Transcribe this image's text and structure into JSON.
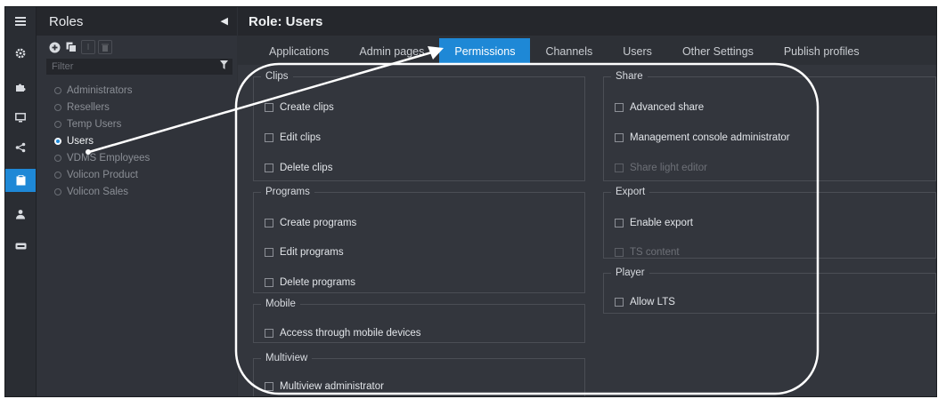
{
  "rail": {
    "items": [
      {
        "icon": "menu-icon"
      },
      {
        "icon": "gear-icon"
      },
      {
        "icon": "puzzle-icon"
      },
      {
        "icon": "monitor-icon"
      },
      {
        "icon": "share-icon"
      },
      {
        "icon": "clipboard-icon"
      },
      {
        "icon": "user-icon"
      },
      {
        "icon": "device-icon"
      }
    ]
  },
  "sidebar": {
    "title": "Roles",
    "filter_placeholder": "Filter",
    "roles": [
      "Administrators",
      "Resellers",
      "Temp Users",
      "Users",
      "VDMS Employees",
      "Volicon Product",
      "Volicon Sales"
    ],
    "selected": "Users"
  },
  "main": {
    "title": "Role: Users",
    "tabs": [
      "Applications",
      "Admin pages",
      "Permissions",
      "Channels",
      "Users",
      "Other Settings",
      "Publish profiles"
    ],
    "active_tab": "Permissions"
  },
  "groups": {
    "clips": {
      "title": "Clips",
      "items": [
        "Create clips",
        "Edit clips",
        "Delete clips"
      ]
    },
    "programs": {
      "title": "Programs",
      "items": [
        "Create programs",
        "Edit programs",
        "Delete programs"
      ]
    },
    "mobile": {
      "title": "Mobile",
      "items": [
        "Access through mobile devices"
      ]
    },
    "multiview": {
      "title": "Multiview",
      "items": [
        "Multiview administrator"
      ]
    },
    "share": {
      "title": "Share",
      "items": [
        "Advanced share",
        "Management console administrator",
        "Share light editor"
      ]
    },
    "export": {
      "title": "Export",
      "items": [
        "Enable export",
        "TS content"
      ]
    },
    "player": {
      "title": "Player",
      "items": [
        "Allow LTS"
      ]
    }
  },
  "colors": {
    "accent": "#1e88d6",
    "annotation": "#ffffff"
  }
}
